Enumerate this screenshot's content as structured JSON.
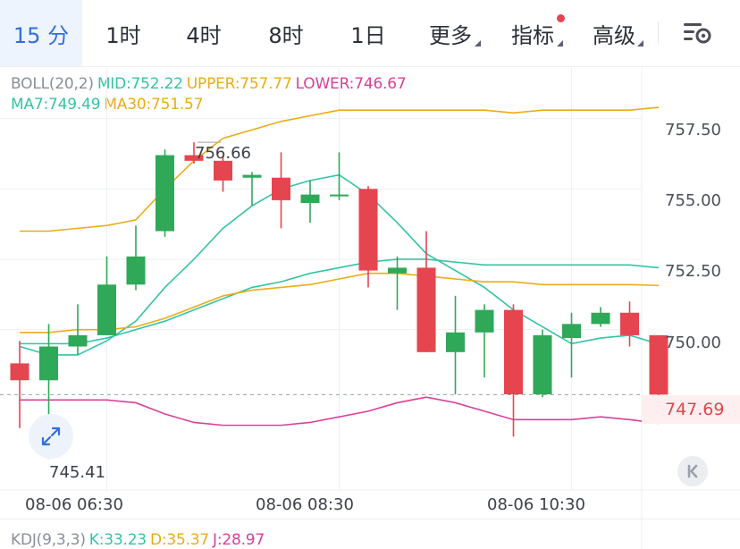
{
  "tabs": [
    {
      "label": "15 分",
      "active": true
    },
    {
      "label": "1时"
    },
    {
      "label": "4时"
    },
    {
      "label": "8时"
    },
    {
      "label": "1日"
    },
    {
      "label": "更多",
      "dropdown": true
    },
    {
      "label": "指标",
      "dropdown": true,
      "badge": true
    },
    {
      "label": "高级",
      "dropdown": true
    }
  ],
  "boll": {
    "name": "BOLL(20,2)",
    "mid": "MID:752.22",
    "upper": "UPPER:757.77",
    "lower": "LOWER:746.67"
  },
  "ma": {
    "ma7": "MA7:749.49",
    "ma30": "MA30:751.57"
  },
  "kdj": {
    "name": "KDJ(9,3,3)",
    "k": "K:33.23",
    "d": "D:35.37",
    "j": "J:28.97"
  },
  "colors": {
    "up": "#2fa858",
    "down": "#e5454f",
    "mid": "#33c3a5",
    "upper": "#e9ad14",
    "lower": "#d9409a",
    "accent": "#2f6fde"
  },
  "chart_data": {
    "type": "candlestick",
    "ylim": [
      744.3,
      759.3
    ],
    "yticks": [
      "757.50",
      "755.00",
      "752.50",
      "750.00"
    ],
    "xticks": [
      "08-06 06:30",
      "08-06 08:30",
      "08-06 10:30"
    ],
    "xtick_index": [
      3,
      11,
      19
    ],
    "last_price": "747.69",
    "high_label": "756.66",
    "low_label": "745.41",
    "high_index": 6,
    "low_index": 0,
    "candles": [
      {
        "o": 748.8,
        "h": 749.6,
        "l": 746.5,
        "c": 748.2
      },
      {
        "o": 748.2,
        "h": 750.2,
        "l": 745.41,
        "c": 749.4
      },
      {
        "o": 749.4,
        "h": 750.9,
        "l": 749.1,
        "c": 749.8
      },
      {
        "o": 749.8,
        "h": 752.6,
        "l": 749.8,
        "c": 751.6
      },
      {
        "o": 751.6,
        "h": 753.7,
        "l": 751.4,
        "c": 752.6
      },
      {
        "o": 753.5,
        "h": 756.4,
        "l": 753.3,
        "c": 756.2
      },
      {
        "o": 756.2,
        "h": 756.66,
        "l": 755.9,
        "c": 756.0
      },
      {
        "o": 756.0,
        "h": 756.2,
        "l": 754.9,
        "c": 755.3
      },
      {
        "o": 755.4,
        "h": 755.6,
        "l": 754.4,
        "c": 755.5
      },
      {
        "o": 755.4,
        "h": 756.3,
        "l": 753.6,
        "c": 754.6
      },
      {
        "o": 754.5,
        "h": 755.3,
        "l": 753.8,
        "c": 754.8
      },
      {
        "o": 754.8,
        "h": 756.3,
        "l": 754.6,
        "c": 754.8
      },
      {
        "o": 755.0,
        "h": 755.1,
        "l": 751.5,
        "c": 752.1
      },
      {
        "o": 752.0,
        "h": 752.6,
        "l": 750.7,
        "c": 752.2
      },
      {
        "o": 752.2,
        "h": 753.5,
        "l": 749.2,
        "c": 749.2
      },
      {
        "o": 749.2,
        "h": 751.2,
        "l": 747.7,
        "c": 749.9
      },
      {
        "o": 749.9,
        "h": 750.9,
        "l": 748.3,
        "c": 750.7
      },
      {
        "o": 750.7,
        "h": 750.9,
        "l": 746.2,
        "c": 747.7
      },
      {
        "o": 747.7,
        "h": 750.0,
        "l": 747.6,
        "c": 749.8
      },
      {
        "o": 749.7,
        "h": 750.6,
        "l": 748.3,
        "c": 750.2
      },
      {
        "o": 750.2,
        "h": 750.8,
        "l": 750.1,
        "c": 750.6
      },
      {
        "o": 750.6,
        "h": 751.0,
        "l": 749.4,
        "c": 749.8
      },
      {
        "o": 749.8,
        "h": 749.8,
        "l": 747.6,
        "c": 747.69
      }
    ],
    "series": [
      {
        "key": "upper",
        "values": [
          753.5,
          753.5,
          753.6,
          753.7,
          753.9,
          755.0,
          756.0,
          756.8,
          757.1,
          757.4,
          757.6,
          757.8,
          757.8,
          757.8,
          757.8,
          757.8,
          757.8,
          757.7,
          757.8,
          757.8,
          757.8,
          757.8,
          757.9
        ]
      },
      {
        "key": "mid",
        "values": [
          749.5,
          749.5,
          749.5,
          749.7,
          750.0,
          750.3,
          750.7,
          751.1,
          751.5,
          751.7,
          752.0,
          752.2,
          752.4,
          752.5,
          752.5,
          752.4,
          752.3,
          752.3,
          752.3,
          752.3,
          752.3,
          752.3,
          752.2
        ]
      },
      {
        "key": "lower",
        "values": [
          747.5,
          747.5,
          747.5,
          747.5,
          747.4,
          747.0,
          746.7,
          746.6,
          746.6,
          746.6,
          746.7,
          746.9,
          747.1,
          747.4,
          747.6,
          747.4,
          747.1,
          746.8,
          746.8,
          746.8,
          746.9,
          746.8,
          746.67
        ]
      },
      {
        "key": "ma7",
        "values": [
          749.4,
          749.1,
          749.1,
          749.6,
          750.3,
          751.5,
          752.5,
          753.6,
          754.4,
          755.0,
          755.3,
          755.5,
          754.8,
          753.8,
          752.7,
          752.1,
          751.5,
          750.7,
          750.1,
          749.5,
          749.7,
          749.8,
          749.49
        ]
      },
      {
        "key": "ma30",
        "values": [
          749.9,
          749.9,
          750.0,
          750.0,
          750.1,
          750.4,
          750.8,
          751.2,
          751.4,
          751.5,
          751.6,
          751.8,
          752.0,
          752.0,
          751.9,
          751.8,
          751.7,
          751.7,
          751.6,
          751.6,
          751.6,
          751.6,
          751.57
        ]
      }
    ]
  }
}
